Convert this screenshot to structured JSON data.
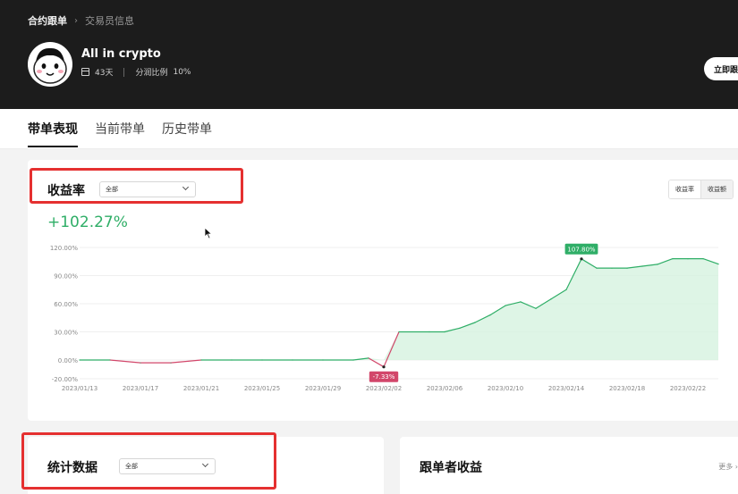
{
  "header": {
    "breadcrumb": {
      "root": "合约跟单",
      "current": "交易员信息"
    },
    "trader_name": "All in crypto",
    "days": "43天",
    "share_label": "分润比例",
    "share_value": "10%",
    "follow_button": "立即跟"
  },
  "tabs": [
    {
      "label": "带单表现",
      "active": true
    },
    {
      "label": "当前带单",
      "active": false
    },
    {
      "label": "历史带单",
      "active": false
    }
  ],
  "roi_panel": {
    "title": "收益率",
    "filter": "全部",
    "toggle": [
      "收益率",
      "收益额"
    ],
    "total_roi": "+102.27%",
    "colors": {
      "positive": "#2fae67",
      "negative": "#d2466a",
      "fill": "#d6f2e0"
    }
  },
  "chart_data": {
    "type": "area",
    "x": [
      "2023/01/13",
      "2023/01/15",
      "2023/01/17",
      "2023/01/19",
      "2023/01/21",
      "2023/01/23",
      "2023/01/25",
      "2023/01/27",
      "2023/01/29",
      "2023/01/31",
      "2023/02/01",
      "2023/02/02",
      "2023/02/03",
      "2023/02/05",
      "2023/02/06",
      "2023/02/07",
      "2023/02/08",
      "2023/02/09",
      "2023/02/10",
      "2023/02/11",
      "2023/02/12",
      "2023/02/13",
      "2023/02/14",
      "2023/02/15",
      "2023/02/16",
      "2023/02/17",
      "2023/02/18",
      "2023/02/19",
      "2023/02/20",
      "2023/02/21",
      "2023/02/22",
      "2023/02/23",
      "2023/02/24"
    ],
    "series": [
      {
        "values": [
          0,
          0,
          -3,
          -3,
          0,
          0,
          0,
          0,
          0,
          0,
          2,
          -7.33,
          30,
          30,
          30,
          34,
          40,
          48,
          58,
          62,
          55,
          65,
          75,
          107.8,
          98,
          98,
          98,
          100,
          102,
          108,
          108,
          108,
          102.27
        ]
      }
    ],
    "xticks": [
      "2023/01/13",
      "2023/01/17",
      "2023/01/21",
      "2023/01/25",
      "2023/01/29",
      "2023/02/02",
      "2023/02/06",
      "2023/02/10",
      "2023/02/14",
      "2023/02/18",
      "2023/02/22"
    ],
    "yticks": [
      "120.00%",
      "90.00%",
      "60.00%",
      "30.00%",
      "0.00%",
      "-20.00%"
    ],
    "ylim": [
      -20,
      120
    ],
    "annotations": [
      {
        "x": "2023/02/02",
        "y": -7.33,
        "label": "-7.33%"
      },
      {
        "x": "2023/02/15",
        "y": 107.8,
        "label": "107.80%"
      }
    ],
    "grid": true
  },
  "stats_panel": {
    "title": "统计数据",
    "filter": "全部"
  },
  "follower_panel": {
    "title": "跟单者收益",
    "more": "更多 ›"
  }
}
